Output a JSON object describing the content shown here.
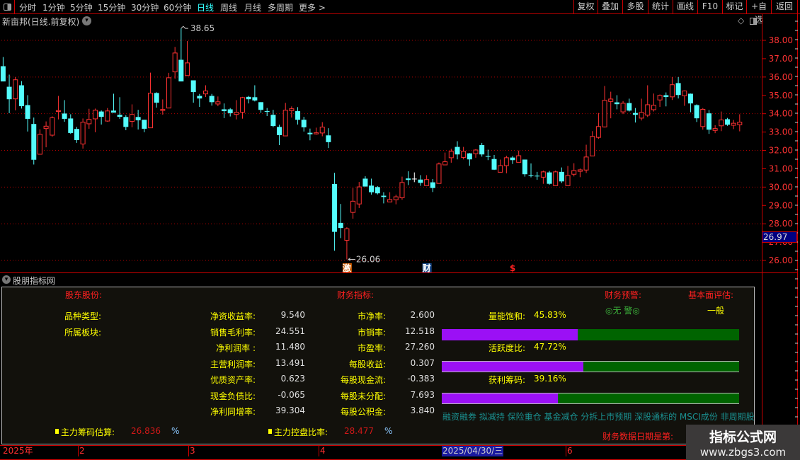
{
  "toolbar": {
    "periods": [
      "分时",
      "1分钟",
      "5分钟",
      "15分钟",
      "30分钟",
      "60分钟",
      "日线",
      "周线",
      "月线",
      "多周期",
      "更多 >"
    ],
    "active_period": "日线",
    "buttons": [
      "复权",
      "叠加",
      "多股",
      "统计",
      "画线",
      "F10",
      "标记",
      "+自选",
      "返回"
    ]
  },
  "chart_title": "新亩邦(日线.前复权)",
  "colors": {
    "up": "#ff3232",
    "down": "#54fcfc",
    "flat": "#ffffff",
    "grid": "#b00000",
    "axis_text": "#ff3333",
    "bar_fill": "#9b10f5",
    "bar_bg": "#006400"
  },
  "chart_data": {
    "type": "candlestick",
    "ylim": [
      25.5,
      38.9
    ],
    "y_ticks": [
      "38.00",
      "37.00",
      "36.00",
      "35.00",
      "34.00",
      "33.00",
      "32.00",
      "31.00",
      "30.00",
      "29.00",
      "28.00",
      "27.00",
      "26.00"
    ],
    "grid_levels": [
      38,
      36,
      34,
      32,
      30,
      28,
      26
    ],
    "high_label": "38.65",
    "low_label": "26.06",
    "current_price": "26.97",
    "markers": [
      {
        "text": "激",
        "candle": 57
      },
      {
        "text": "财",
        "candle": 70
      },
      {
        "text": "$",
        "candle": 84
      }
    ],
    "candles_ohlc": [
      [
        36.59,
        37.09,
        35.76,
        35.76
      ],
      [
        35.47,
        36.13,
        34.03,
        34.79
      ],
      [
        34.81,
        36.0,
        34.18,
        35.85
      ],
      [
        35.55,
        35.78,
        34.28,
        34.41
      ],
      [
        34.47,
        35.01,
        33.03,
        33.72
      ],
      [
        33.44,
        33.79,
        31.23,
        31.49
      ],
      [
        31.79,
        33.15,
        31.79,
        32.88
      ],
      [
        33.19,
        33.58,
        32.17,
        33.32
      ],
      [
        32.83,
        33.86,
        32.74,
        33.78
      ],
      [
        34.12,
        34.97,
        33.69,
        34.17
      ],
      [
        34.01,
        34.74,
        33.56,
        33.72
      ],
      [
        33.74,
        33.97,
        32.9,
        32.95
      ],
      [
        33.17,
        33.28,
        32.41,
        32.56
      ],
      [
        32.35,
        33.74,
        32.1,
        33.54
      ],
      [
        33.45,
        34.27,
        33.18,
        33.69
      ],
      [
        33.72,
        34.28,
        32.99,
        34.19
      ],
      [
        34.12,
        34.18,
        33.41,
        33.83
      ],
      [
        33.6,
        34.31,
        33.56,
        34.15
      ],
      [
        34.17,
        35.09,
        34.06,
        34.06
      ],
      [
        33.94,
        34.9,
        33.72,
        33.83
      ],
      [
        33.82,
        33.92,
        33.1,
        33.28
      ],
      [
        33.58,
        34.51,
        33.26,
        33.96
      ],
      [
        33.82,
        34.21,
        33.14,
        33.64
      ],
      [
        33.67,
        33.67,
        32.99,
        33.18
      ],
      [
        33.23,
        36.24,
        33.23,
        35.12
      ],
      [
        35.13,
        35.17,
        34.33,
        34.6
      ],
      [
        34.18,
        34.78,
        33.95,
        34.23
      ],
      [
        34.31,
        36.23,
        34.31,
        35.96
      ],
      [
        36.28,
        37.64,
        35.91,
        37.31
      ],
      [
        36.94,
        38.65,
        35.76,
        35.76
      ],
      [
        36.08,
        37.96,
        36.08,
        36.77
      ],
      [
        35.82,
        35.82,
        34.6,
        35.18
      ],
      [
        34.97,
        35.08,
        34.37,
        34.83
      ],
      [
        35.08,
        35.55,
        34.91,
        35.24
      ],
      [
        34.97,
        35.08,
        34.44,
        34.63
      ],
      [
        34.53,
        34.94,
        34.41,
        34.65
      ],
      [
        34.24,
        34.56,
        33.76,
        34.14
      ],
      [
        34.24,
        34.31,
        33.85,
        34.03
      ],
      [
        33.96,
        34.74,
        33.69,
        34.08
      ],
      [
        34.08,
        34.92,
        33.73,
        34.88
      ],
      [
        34.92,
        34.97,
        34.56,
        34.79
      ],
      [
        34.9,
        35.55,
        34.67,
        34.72
      ],
      [
        34.63,
        34.63,
        34.05,
        34.21
      ],
      [
        34.14,
        34.31,
        33.87,
        34.12
      ],
      [
        33.94,
        34.21,
        33.26,
        33.33
      ],
      [
        33.28,
        33.4,
        32.29,
        32.83
      ],
      [
        32.79,
        34.59,
        32.79,
        34.19
      ],
      [
        34.17,
        34.4,
        33.79,
        34.27
      ],
      [
        34.14,
        34.36,
        33.41,
        33.67
      ],
      [
        33.67,
        33.83,
        33.03,
        33.26
      ],
      [
        32.96,
        33.19,
        32.55,
        32.88
      ],
      [
        32.9,
        33.24,
        32.86,
        32.96
      ],
      [
        32.95,
        33.54,
        32.77,
        33.27
      ],
      [
        32.82,
        33.21,
        32.13,
        32.45
      ],
      [
        30.17,
        30.78,
        26.53,
        27.56
      ],
      [
        28.05,
        29.08,
        27.22,
        27.77
      ],
      [
        27.1,
        27.81,
        26.06,
        27.73
      ],
      [
        28.62,
        29.95,
        28.28,
        29.23
      ],
      [
        29.08,
        30.28,
        28.86,
        30.01
      ],
      [
        30.46,
        30.59,
        30.03,
        30.03
      ],
      [
        30.08,
        30.46,
        29.59,
        29.72
      ],
      [
        30.0,
        30.05,
        29.6,
        29.66
      ],
      [
        29.53,
        29.72,
        29.11,
        29.46
      ],
      [
        29.19,
        29.72,
        29.19,
        29.32
      ],
      [
        29.31,
        29.59,
        29.06,
        29.47
      ],
      [
        29.42,
        30.57,
        29.31,
        30.25
      ],
      [
        30.47,
        30.86,
        30.11,
        30.39
      ],
      [
        30.46,
        30.8,
        30.27,
        30.46
      ],
      [
        30.41,
        30.65,
        30.07,
        30.23
      ],
      [
        30.08,
        30.65,
        30.08,
        30.41
      ],
      [
        30.26,
        30.44,
        29.73,
        29.95
      ],
      [
        30.2,
        31.34,
        30.2,
        31.26
      ],
      [
        31.21,
        31.88,
        31.21,
        31.38
      ],
      [
        31.6,
        32.09,
        31.33,
        31.95
      ],
      [
        32.19,
        32.5,
        31.51,
        31.78
      ],
      [
        31.62,
        32.19,
        31.51,
        31.95
      ],
      [
        31.84,
        31.86,
        31.16,
        31.51
      ],
      [
        31.82,
        32.07,
        31.6,
        32.02
      ],
      [
        32.29,
        32.41,
        31.66,
        31.78
      ],
      [
        31.69,
        32.04,
        31.47,
        31.65
      ],
      [
        31.53,
        31.75,
        30.93,
        30.95
      ],
      [
        30.81,
        31.5,
        30.81,
        31.17
      ],
      [
        31.17,
        31.71,
        30.75,
        31.6
      ],
      [
        31.61,
        31.69,
        31.26,
        31.47
      ],
      [
        31.35,
        31.99,
        31.35,
        31.71
      ],
      [
        31.5,
        31.5,
        30.57,
        30.7
      ],
      [
        30.65,
        31.29,
        30.53,
        30.61
      ],
      [
        30.62,
        30.83,
        30.4,
        30.59
      ],
      [
        30.54,
        30.9,
        30.18,
        30.83
      ],
      [
        30.8,
        30.88,
        30.13,
        30.18
      ],
      [
        30.08,
        30.9,
        30.08,
        30.83
      ],
      [
        30.83,
        31.07,
        30.22,
        30.31
      ],
      [
        30.08,
        31.15,
        30.08,
        30.63
      ],
      [
        30.7,
        31.3,
        30.58,
        30.9
      ],
      [
        30.86,
        31.01,
        30.54,
        30.94
      ],
      [
        30.93,
        32.31,
        30.77,
        31.64
      ],
      [
        31.7,
        33.05,
        31.7,
        32.76
      ],
      [
        32.71,
        34.04,
        32.63,
        33.3
      ],
      [
        33.28,
        35.51,
        33.25,
        34.73
      ],
      [
        34.67,
        35.2,
        33.75,
        34.8
      ],
      [
        34.62,
        35.01,
        34.24,
        34.52
      ],
      [
        34.1,
        34.69,
        33.98,
        34.57
      ],
      [
        34.58,
        34.82,
        34.12,
        34.17
      ],
      [
        34.04,
        34.31,
        33.52,
        33.94
      ],
      [
        33.76,
        34.82,
        33.63,
        34.07
      ],
      [
        33.92,
        35.55,
        33.82,
        34.49
      ],
      [
        34.22,
        35.1,
        34.12,
        34.46
      ],
      [
        34.75,
        35.05,
        34.37,
        35.0
      ],
      [
        35.01,
        35.16,
        34.4,
        34.91
      ],
      [
        34.92,
        36.0,
        34.75,
        35.58
      ],
      [
        35.67,
        36.0,
        34.83,
        35.02
      ],
      [
        34.98,
        35.27,
        34.43,
        35.24
      ],
      [
        35.09,
        35.1,
        34.08,
        34.56
      ],
      [
        34.47,
        34.51,
        33.55,
        33.75
      ],
      [
        33.3,
        34.31,
        33.13,
        34.24
      ],
      [
        34.02,
        34.2,
        32.9,
        33.13
      ],
      [
        33.09,
        33.37,
        32.94,
        33.19
      ],
      [
        33.34,
        34.12,
        33.05,
        33.66
      ],
      [
        33.7,
        33.77,
        33.34,
        33.4
      ],
      [
        33.37,
        33.66,
        33.16,
        33.48
      ],
      [
        33.4,
        33.97,
        33.04,
        33.54
      ]
    ]
  },
  "indicator_panel": {
    "title": "股朋指标网",
    "headers": {
      "shareholders": "股东股份:",
      "financial": "财务指标:",
      "warning": "财务预警:",
      "fundamental": "基本面评估:"
    },
    "warning_value": "◎无 警◎",
    "fundamental_value": "一般",
    "info_labels": [
      "品种类型:",
      "所属板块:"
    ],
    "col1": [
      {
        "label": "净资收益率:",
        "value": "9.540"
      },
      {
        "label": "销售毛利率:",
        "value": "24.551"
      },
      {
        "label": "净利润率 :",
        "value": "11.480"
      },
      {
        "label": "主营利润率:",
        "value": "13.491"
      },
      {
        "label": "优质资产率:",
        "value": "0.623"
      },
      {
        "label": "现金负债比:",
        "value": "-0.065"
      },
      {
        "label": "净利同增率:",
        "value": "39.304"
      }
    ],
    "col2": [
      {
        "label": "市净率:",
        "value": "2.600"
      },
      {
        "label": "市销率:",
        "value": "12.518"
      },
      {
        "label": "市盈率:",
        "value": "27.260"
      },
      {
        "label": "每股收益:",
        "value": "0.307"
      },
      {
        "label": "每股现金流:",
        "value": "-0.383"
      },
      {
        "label": "每股未分配:",
        "value": "7.693"
      },
      {
        "label": "每股公积金:",
        "value": "3.840"
      }
    ],
    "bars": [
      {
        "label": "量能饱和:",
        "value": "45.83%",
        "fraction": 0.4583
      },
      {
        "label": "活跃度比:",
        "value": "47.72%",
        "fraction": 0.4772
      },
      {
        "label": "获利筹码:",
        "value": "39.16%",
        "fraction": 0.3916
      }
    ],
    "tags": "融资融券 拟减持 保险重仓 基金减仓 分拆上市预期 深股通标的 MSCI成份 非周期股",
    "chip_estimate": {
      "label": "主力筹码估算:",
      "value": "26.836",
      "unit": "%"
    },
    "control_ratio": {
      "label": "主力控盘比率:",
      "value": "28.477",
      "unit": "%"
    },
    "date_note": "财务数据日期是第:"
  },
  "date_axis": {
    "labels": [
      "2025年",
      "2",
      "3",
      "4",
      "2025/04/30/三",
      "6"
    ]
  },
  "watermark": {
    "title": "指标公式网",
    "url": "www.zbgs3.com"
  }
}
